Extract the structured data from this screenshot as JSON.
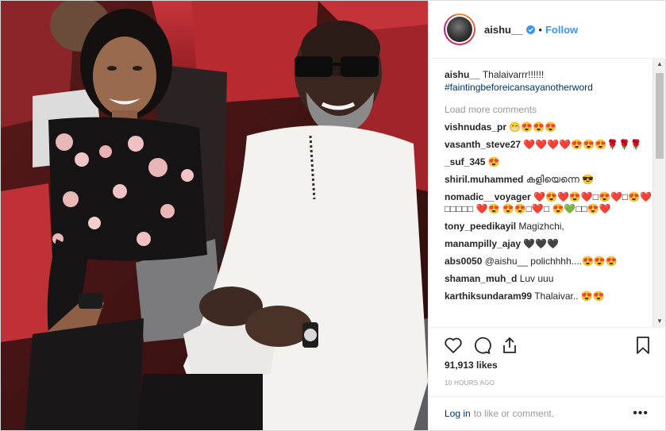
{
  "post": {
    "username": "aishu__",
    "follow_label": "Follow",
    "separator": "•",
    "caption": {
      "username": "aishu__",
      "text": "Thalaivarrr!!!!!!",
      "hashtag": "#faintingbeforeicansayanotherword"
    },
    "load_more": "Load more comments",
    "comments": [
      {
        "user": "vishnudas_pr",
        "text": "😁😍😍😍"
      },
      {
        "user": "vasanth_steve27",
        "text": "❤️❤️❤️❤️😍😍😍🌹🌹🌹"
      },
      {
        "user": "_suf_345",
        "text": "😍"
      },
      {
        "user": "shiril.muhammed",
        "text": "കളിയെന്നെ 😎"
      },
      {
        "user": "nomadic__voyager",
        "text": "❤️😍❤️😍❤️□😍❤️□😍❤️□□□□□ ❤️😍 😍😍□❤️□ 😍💚□□😍❤️"
      },
      {
        "user": "tony_peedikayil",
        "text": "Magizhchi,"
      },
      {
        "user": "manampilly_ajay",
        "text": "🖤🖤🖤"
      },
      {
        "user": "abs0050",
        "text": "@aishu__ polichhhh....😍😍😍"
      },
      {
        "user": "shaman_muh_d",
        "text": "Luv uuu"
      },
      {
        "user": "karthiksundaram99",
        "text": "Thalaivar.. 😍😍"
      }
    ],
    "likes": "91,913 likes",
    "time": "10 HOURS AGO",
    "footer": {
      "login": "Log in",
      "rest": "to like or comment.",
      "more": "•••"
    }
  },
  "icons": {
    "heart": "heart-icon",
    "comment": "comment-icon",
    "share": "share-icon",
    "save": "bookmark-icon",
    "verified": "verified-badge-icon"
  },
  "colors": {
    "link_blue": "#3897f0",
    "dark_link": "#003569",
    "muted": "#999999",
    "border": "#efefef"
  }
}
